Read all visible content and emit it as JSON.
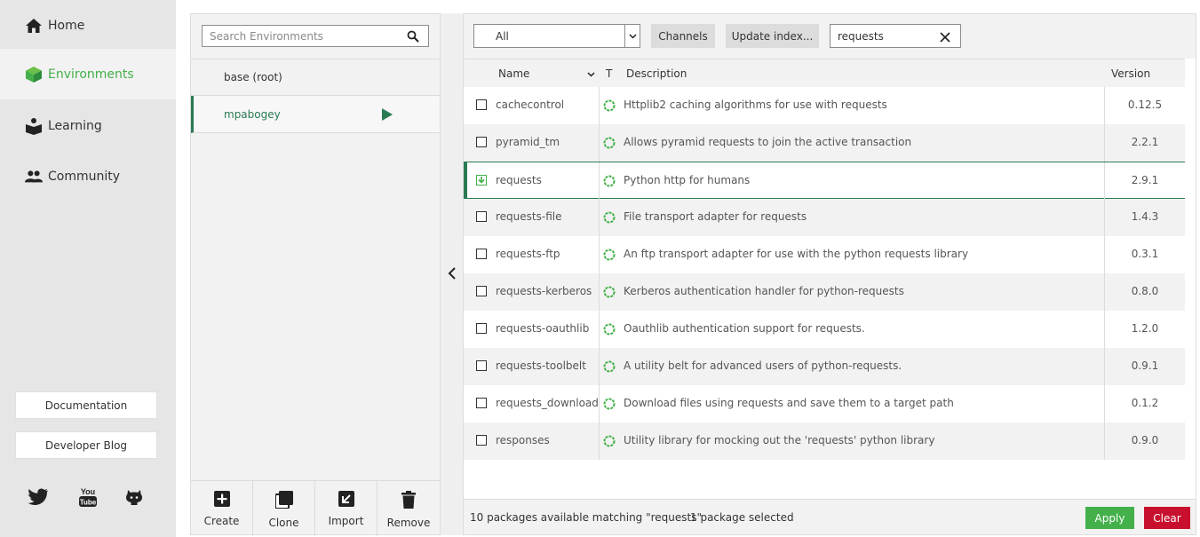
{
  "nav": {
    "items": [
      {
        "label": "Home",
        "icon": "home-icon"
      },
      {
        "label": "Environments",
        "icon": "cube-icon",
        "active": true
      },
      {
        "label": "Learning",
        "icon": "book-icon"
      },
      {
        "label": "Community",
        "icon": "people-icon"
      }
    ],
    "documentation_label": "Documentation",
    "blog_label": "Developer Blog",
    "social": [
      "twitter-icon",
      "youtube-icon",
      "github-icon"
    ]
  },
  "environments": {
    "search_placeholder": "Search Environments",
    "items": [
      {
        "name": "base (root)",
        "active": false
      },
      {
        "name": "mpabogey",
        "active": true
      }
    ],
    "actions": [
      {
        "label": "Create",
        "icon": "add-icon"
      },
      {
        "label": "Clone",
        "icon": "clone-icon"
      },
      {
        "label": "Import",
        "icon": "import-icon"
      },
      {
        "label": "Remove",
        "icon": "trash-icon"
      }
    ]
  },
  "packages": {
    "filter_value": "All",
    "channels_label": "Channels",
    "update_label": "Update index...",
    "search_value": "requests",
    "columns": {
      "name": "Name",
      "type": "T",
      "description": "Description",
      "version": "Version"
    },
    "rows": [
      {
        "name": "cachecontrol",
        "description": "Httplib2 caching algorithms for use with requests",
        "version": "0.12.5"
      },
      {
        "name": "pyramid_tm",
        "description": "Allows pyramid requests to join the active transaction",
        "version": "2.2.1"
      },
      {
        "name": "requests",
        "description": "Python http for humans",
        "version": "2.9.1",
        "selected": true
      },
      {
        "name": "requests-file",
        "description": "File transport adapter for requests",
        "version": "1.4.3"
      },
      {
        "name": "requests-ftp",
        "description": "An ftp transport adapter for use with the python requests library",
        "version": "0.3.1"
      },
      {
        "name": "requests-kerberos",
        "description": "Kerberos authentication handler for python-requests",
        "version": "0.8.0"
      },
      {
        "name": "requests-oauthlib",
        "description": "Oauthlib authentication support for requests.",
        "version": "1.2.0"
      },
      {
        "name": "requests-toolbelt",
        "description": "A utility belt for advanced users of python-requests.",
        "version": "0.9.1"
      },
      {
        "name": "requests_download",
        "description": "Download files using requests and save them to a target path",
        "version": "0.1.2"
      },
      {
        "name": "responses",
        "description": "Utility library for mocking out the 'requests' python library",
        "version": "0.9.0"
      }
    ],
    "footer_count": "10 packages available matching \"requests\"",
    "footer_selected": "1 package selected",
    "apply_label": "Apply",
    "clear_label": "Clear"
  },
  "colors": {
    "accent": "#43b049",
    "selected_border": "#2a7a52",
    "apply": "#43b049",
    "clear": "#c8102e"
  }
}
